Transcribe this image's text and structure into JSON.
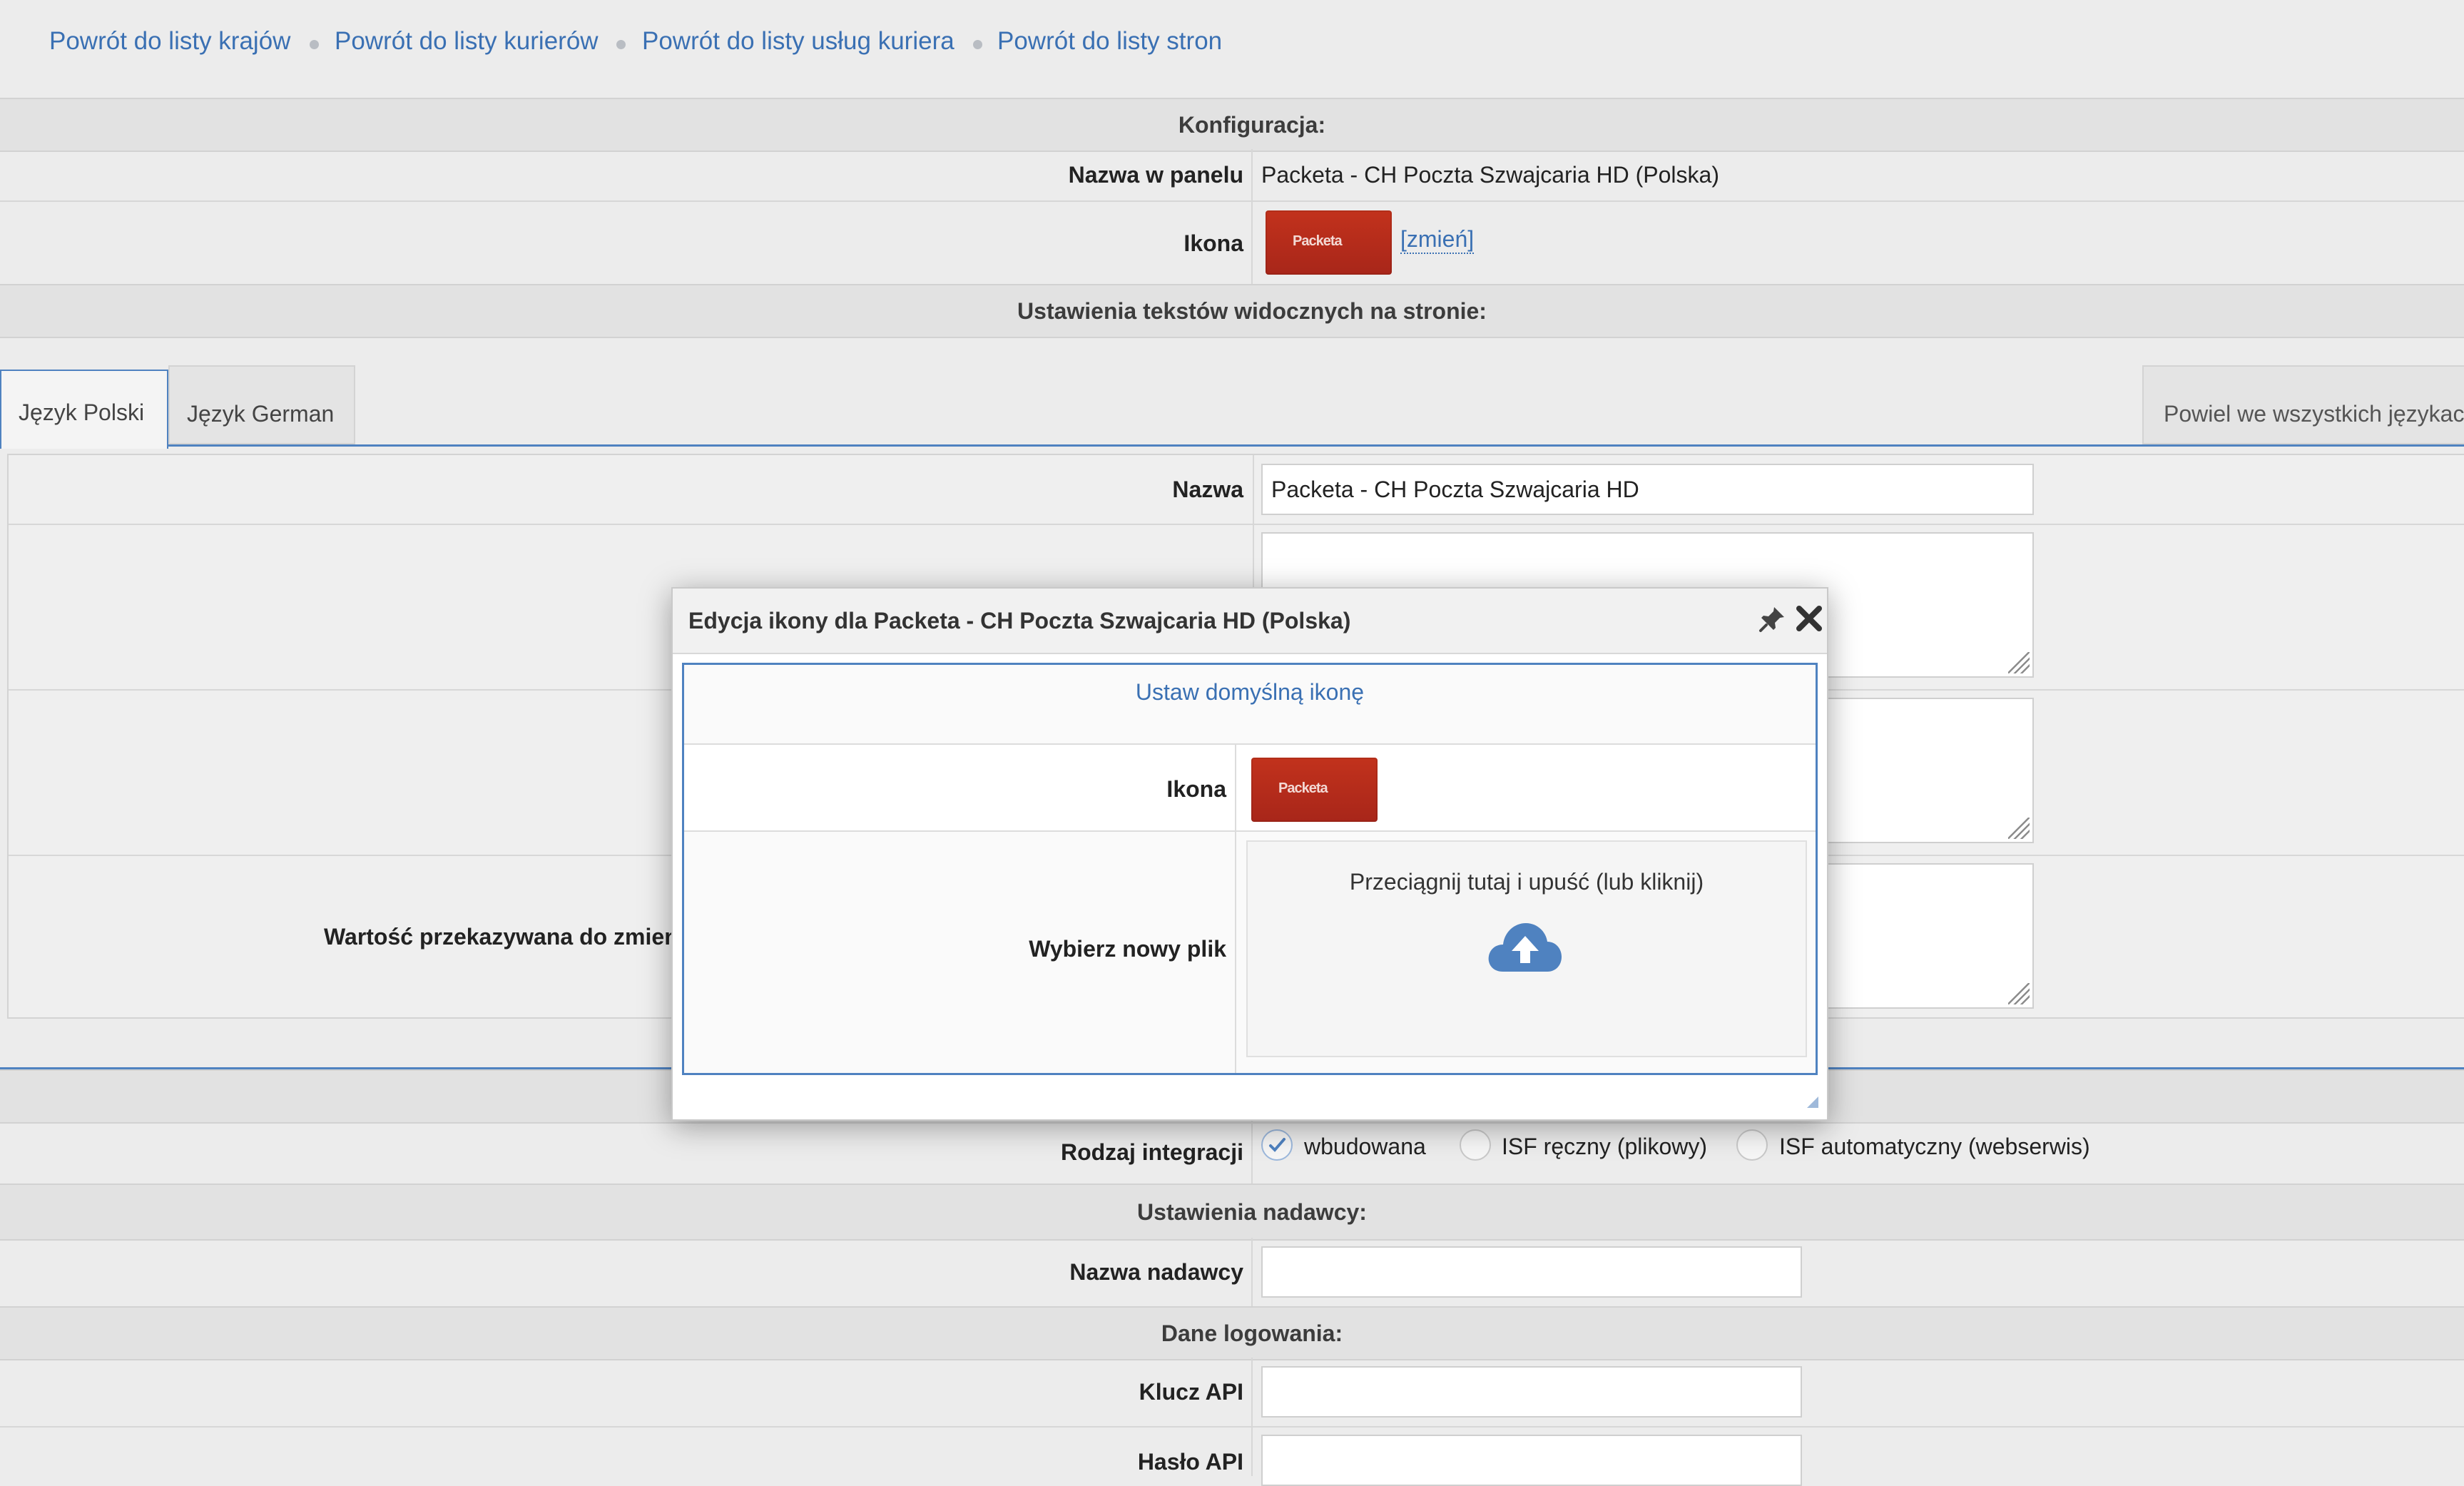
{
  "breadcrumb": [
    "Powrót do listy krajów",
    "Powrót do listy kurierów",
    "Powrót do listy usług kuriera",
    "Powrót do listy stron"
  ],
  "config": {
    "section_title": "Konfiguracja:",
    "panel_name_label": "Nazwa w panelu",
    "panel_name_value": "Packeta - CH Poczta Szwajcaria HD (Polska)",
    "icon_label": "Ikona",
    "change_link": "[zmień]"
  },
  "texts_section_title": "Ustawienia tekstów widocznych na stronie:",
  "tabs": [
    "Język Polski",
    "Język German"
  ],
  "copy_all_languages": "Powiel we wszystkich językach",
  "name_label": "Nazwa",
  "name_value": "Packeta - CH Poczta Szwajcaria HD",
  "passed_value_label": "Wartość przekazywana do zmiennej",
  "integration": {
    "label": "Rodzaj integracji",
    "options": [
      "wbudowana",
      "ISF ręczny (plikowy)",
      "ISF automatyczny (webserwis)"
    ],
    "selected": "wbudowana"
  },
  "sender_section_title": "Ustawienia nadawcy:",
  "sender_name_label": "Nazwa nadawcy",
  "login_section_title": "Dane logowania:",
  "api_key_label": "Klucz API",
  "api_password_label": "Hasło API",
  "logo_text": "Packeta",
  "dialog": {
    "title": "Edycja ikony dla Packeta - CH Poczta Szwajcaria HD (Polska)",
    "set_default_link": "Ustaw domyślną ikonę",
    "icon_label": "Ikona",
    "new_file_label": "Wybierz nowy plik",
    "drop_text": "Przeciągnij tutaj i upuść (lub kliknij)"
  },
  "colors": {
    "link": "#3a70b3",
    "logo_red": "#b52b1c",
    "accent_blue": "#4f82c0"
  }
}
